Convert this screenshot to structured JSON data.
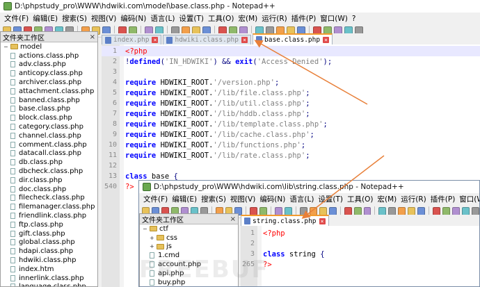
{
  "window1": {
    "title": "D:\\phpstudy_pro\\WWW\\hdwiki.com\\model\\base.class.php - Notepad++",
    "menu": [
      "文件(F)",
      "编辑(E)",
      "搜索(S)",
      "视图(V)",
      "编码(N)",
      "语言(L)",
      "设置(T)",
      "工具(O)",
      "宏(M)",
      "运行(R)",
      "插件(P)",
      "窗口(W)",
      "?"
    ],
    "panel_title": "文件夹工作区",
    "panel_close": "×",
    "root_folder": "model",
    "files": [
      "actions.class.php",
      "adv.class.php",
      "anticopy.class.php",
      "archiver.class.php",
      "attachment.class.php",
      "banned.class.php",
      "base.class.php",
      "block.class.php",
      "category.class.php",
      "channel.class.php",
      "comment.class.php",
      "datacall.class.php",
      "db.class.php",
      "dbcheck.class.php",
      "dir.class.php",
      "doc.class.php",
      "filecheck.class.php",
      "filemanager.class.php",
      "friendlink.class.php",
      "ftp.class.php",
      "gift.class.php",
      "global.class.php",
      "hdapi.class.php",
      "hdwiki.class.php",
      "index.htm",
      "innerlink.class.php",
      "language.class.php"
    ],
    "tabs": [
      {
        "label": "index.php",
        "active": false
      },
      {
        "label": "hdwiki.class.php",
        "active": false
      },
      {
        "label": "base.class.php",
        "active": true
      }
    ],
    "tab_close": "×",
    "code": [
      {
        "n": "1",
        "parts": [
          {
            "c": "ph",
            "t": "<?php"
          }
        ]
      },
      {
        "n": "2",
        "parts": [
          {
            "c": "op",
            "t": "!"
          },
          {
            "c": "kw",
            "t": "defined"
          },
          {
            "c": "op",
            "t": "("
          },
          {
            "c": "st",
            "t": "'IN_HDWIKI'"
          },
          {
            "c": "op",
            "t": ") && "
          },
          {
            "c": "kw",
            "t": "exit"
          },
          {
            "c": "op",
            "t": "("
          },
          {
            "c": "st",
            "t": "'Access Denied'"
          },
          {
            "c": "op",
            "t": ");"
          }
        ]
      },
      {
        "n": "3",
        "parts": []
      },
      {
        "n": "4",
        "parts": [
          {
            "c": "kw",
            "t": "require"
          },
          {
            "c": "",
            "t": " HDWIKI_ROOT."
          },
          {
            "c": "st",
            "t": "'/version.php'"
          },
          {
            "c": "op",
            "t": ";"
          }
        ]
      },
      {
        "n": "5",
        "parts": [
          {
            "c": "kw",
            "t": "require"
          },
          {
            "c": "",
            "t": " HDWIKI_ROOT."
          },
          {
            "c": "st",
            "t": "'/lib/file.class.php'"
          },
          {
            "c": "op",
            "t": ";"
          }
        ]
      },
      {
        "n": "6",
        "parts": [
          {
            "c": "kw",
            "t": "require"
          },
          {
            "c": "",
            "t": " HDWIKI_ROOT."
          },
          {
            "c": "st",
            "t": "'/lib/util.class.php'"
          },
          {
            "c": "op",
            "t": ";"
          }
        ]
      },
      {
        "n": "7",
        "parts": [
          {
            "c": "kw",
            "t": "require"
          },
          {
            "c": "",
            "t": " HDWIKI_ROOT."
          },
          {
            "c": "st",
            "t": "'/lib/hddb.class.php'"
          },
          {
            "c": "op",
            "t": ";"
          }
        ]
      },
      {
        "n": "8",
        "parts": [
          {
            "c": "kw",
            "t": "require"
          },
          {
            "c": "",
            "t": " HDWIKI_ROOT."
          },
          {
            "c": "st",
            "t": "'/lib/template.class.php'"
          },
          {
            "c": "op",
            "t": ";"
          }
        ]
      },
      {
        "n": "9",
        "parts": [
          {
            "c": "kw",
            "t": "require"
          },
          {
            "c": "",
            "t": " HDWIKI_ROOT."
          },
          {
            "c": "st",
            "t": "'/lib/cache.class.php'"
          },
          {
            "c": "op",
            "t": ";"
          }
        ]
      },
      {
        "n": "10",
        "parts": [
          {
            "c": "kw",
            "t": "require"
          },
          {
            "c": "",
            "t": " HDWIKI_ROOT."
          },
          {
            "c": "st",
            "t": "'/lib/functions.php'"
          },
          {
            "c": "op",
            "t": ";"
          }
        ]
      },
      {
        "n": "11",
        "parts": [
          {
            "c": "kw",
            "t": "require"
          },
          {
            "c": "",
            "t": " HDWIKI_ROOT."
          },
          {
            "c": "st",
            "t": "'/lib/rate.class.php'"
          },
          {
            "c": "op",
            "t": ";"
          }
        ]
      },
      {
        "n": "12",
        "parts": []
      },
      {
        "n": "13",
        "parts": [
          {
            "c": "kw",
            "t": "class"
          },
          {
            "c": "",
            "t": " base "
          },
          {
            "c": "op",
            "t": "{"
          }
        ]
      },
      {
        "n": "540",
        "parts": [
          {
            "c": "ph",
            "t": "?>"
          }
        ]
      }
    ]
  },
  "window2": {
    "title": "D:\\phpstudy_pro\\WWW\\hdwiki.com\\lib\\string.class.php - Notepad++",
    "menu": [
      "文件(F)",
      "编辑(E)",
      "搜索(S)",
      "视图(V)",
      "编码(N)",
      "语言(L)",
      "设置(T)",
      "工具(O)",
      "宏(M)",
      "运行(R)",
      "插件(P)",
      "窗口(W)",
      "?"
    ],
    "panel_title": "文件夹工作区",
    "panel_close": "×",
    "root_folder": "ctf",
    "folders": [
      "css",
      "js"
    ],
    "files": [
      "1.cmd",
      "account.php",
      "api.php",
      "buy.php"
    ],
    "tabs": [
      {
        "label": "string.class.php",
        "active": true
      }
    ],
    "tab_close": "×",
    "code": [
      {
        "n": "1",
        "parts": [
          {
            "c": "ph",
            "t": "<?php"
          }
        ]
      },
      {
        "n": "2",
        "parts": []
      },
      {
        "n": "3",
        "parts": [
          {
            "c": "kw",
            "t": "class"
          },
          {
            "c": "",
            "t": " string "
          },
          {
            "c": "op",
            "t": "{"
          }
        ]
      },
      {
        "n": "265",
        "parts": [
          {
            "c": "ph",
            "t": "?>"
          }
        ]
      }
    ]
  },
  "watermark": "FREEBUF",
  "colors": {
    "arrow": "#e8803a",
    "active_tab_border": "#f29b2e",
    "keyword": "#0000ff",
    "string": "#808080",
    "php_tag": "#ff0000"
  }
}
